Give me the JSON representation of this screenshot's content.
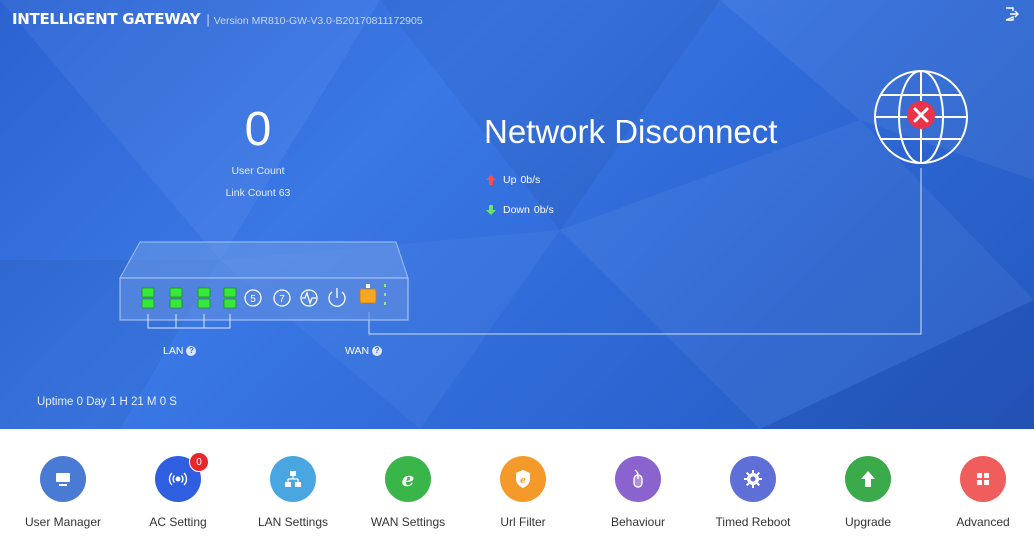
{
  "header": {
    "brand": "INTELLIGENT GATEWAY",
    "separator": "|",
    "version": "Version MR810-GW-V3.0-B20170811172905",
    "logout_icon": "logout-icon"
  },
  "stats": {
    "user_count_value": "0",
    "user_count_label": "User Count",
    "link_count_label": "Link Count 63"
  },
  "network": {
    "status": "Network Disconnect",
    "up_label": "Up",
    "up_value": "0b/s",
    "down_label": "Down",
    "down_value": "0b/s",
    "status_icon": "globe-disconnected-icon"
  },
  "device": {
    "lan_label": "LAN",
    "wan_label": "WAN",
    "help_glyph": "?",
    "port_5": "5",
    "port_7": "7"
  },
  "uptime": "Uptime 0 Day 1 H 21 M 0 S",
  "toolbar": {
    "items": [
      {
        "label": "User Manager",
        "icon": "monitor-icon",
        "color": "#4a7bd4"
      },
      {
        "label": "AC Setting",
        "icon": "wireless-icon",
        "color": "#2f5fe0",
        "badge": "0"
      },
      {
        "label": "LAN Settings",
        "icon": "network-tree-icon",
        "color": "#4aa6e0"
      },
      {
        "label": "WAN Settings",
        "icon": "ie-browser-icon",
        "color": "#39b54a"
      },
      {
        "label": "Url Filter",
        "icon": "url-filter-icon",
        "color": "#f39a2b"
      },
      {
        "label": "Behaviour",
        "icon": "mouse-icon",
        "color": "#8a63cf"
      },
      {
        "label": "Timed Reboot",
        "icon": "gear-icon",
        "color": "#5f6fd8"
      },
      {
        "label": "Upgrade",
        "icon": "upload-arrow-icon",
        "color": "#3aaa4a"
      },
      {
        "label": "Advanced",
        "icon": "grid-icon",
        "color": "#ef5d5d"
      }
    ]
  },
  "colors": {
    "hero_blue": "#2f6bd8",
    "port_green": "#38e838",
    "wan_orange": "#f5a623",
    "disconnect_red": "#e8334a"
  }
}
